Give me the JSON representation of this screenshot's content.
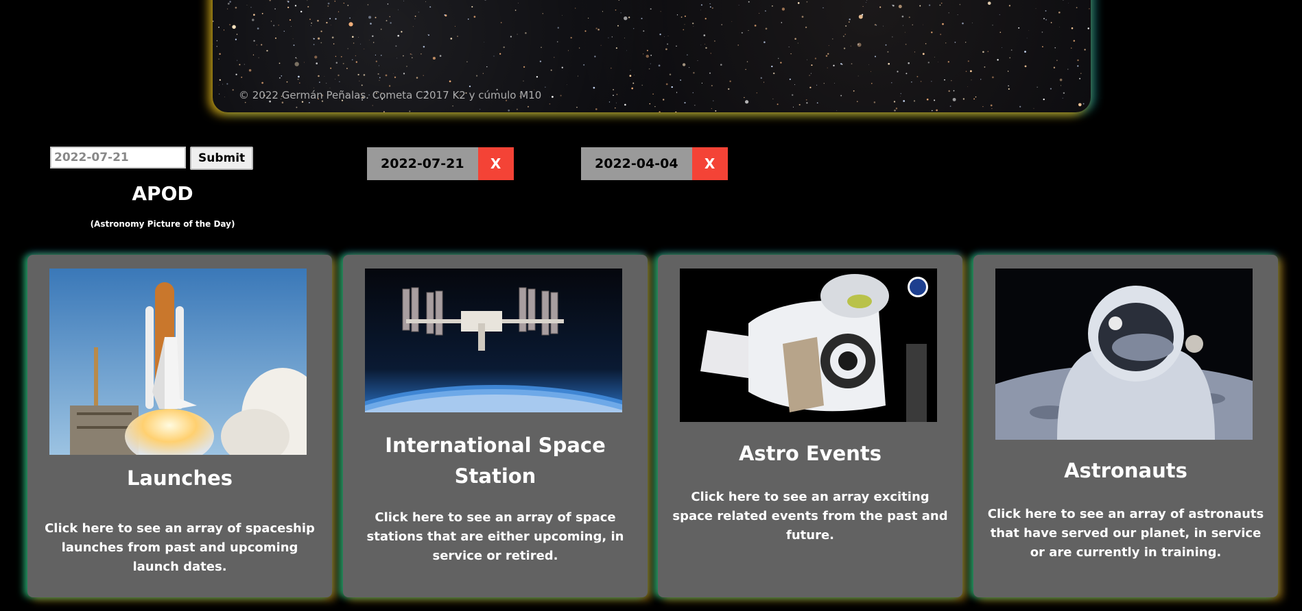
{
  "apod": {
    "credit": "© 2022 Germán Peñalas. Cometa C2017 K2 y cúmulo M10",
    "title": "APOD",
    "subtitle": "(Astronomy Picture of the Day)"
  },
  "date_form": {
    "value": "2022-07-21",
    "submit_label": "Submit"
  },
  "saved_dates": [
    {
      "label": "2022-07-21",
      "remove_label": "X"
    },
    {
      "label": "2022-04-04",
      "remove_label": "X"
    }
  ],
  "cards": [
    {
      "title": "Launches",
      "description": "Click here to see an array of spaceship launches from past and upcoming launch dates."
    },
    {
      "title": "International Space Station",
      "description": "Click here to see an array of space stations that are either upcoming, in service or retired."
    },
    {
      "title": "Astro Events",
      "description": "Click here to see an array exciting space related events from the past and future."
    },
    {
      "title": "Astronauts",
      "description": "Click here to see an array of astronauts that have served our planet, in service or are currently in training."
    }
  ],
  "colors": {
    "background": "#000000",
    "card": "#626262",
    "chip": "#9a9a9a",
    "remove": "#f44336"
  }
}
